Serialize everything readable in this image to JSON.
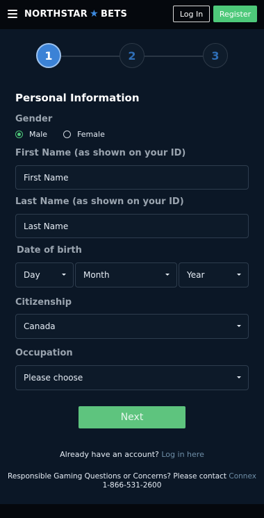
{
  "header": {
    "brand_left": "NORTHSTAR",
    "brand_star": "★",
    "brand_right": "BETS",
    "login_label": "Log In",
    "register_label": "Register"
  },
  "stepper": {
    "steps": [
      "1",
      "2",
      "3"
    ],
    "active_step": 1
  },
  "form": {
    "section_title": "Personal Information",
    "gender_label": "Gender",
    "gender_options": [
      "Male",
      "Female"
    ],
    "gender_selected": "Male",
    "first_name_label": "First Name (as shown on your ID)",
    "first_name_placeholder": "First Name",
    "last_name_label": "Last Name (as shown on your ID)",
    "last_name_placeholder": "Last Name",
    "dob_label": "Date of birth",
    "dob_day": "Day",
    "dob_month": "Month",
    "dob_year": "Year",
    "citizenship_label": "Citizenship",
    "citizenship_value": "Canada",
    "occupation_label": "Occupation",
    "occupation_value": "Please choose",
    "next_label": "Next"
  },
  "already": {
    "text": "Already have an account?",
    "link": "Log in here"
  },
  "footer": {
    "text": "Responsible Gaming Questions or Concerns? Please contact",
    "link": "Connex",
    "phone": "1-866-531-2600"
  },
  "colors": {
    "background": "#0b1726",
    "accent_green": "#4ec97a",
    "step_active": "#3b82d6"
  }
}
